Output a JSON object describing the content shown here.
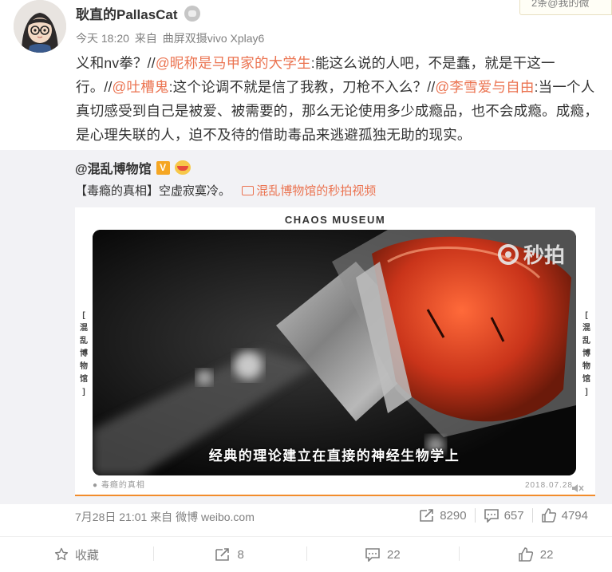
{
  "notice": {
    "text": "2条@我的微"
  },
  "post": {
    "username": "耿直的PallasCat",
    "time": "今天 18:20",
    "from_prefix": "来自",
    "source": "曲屏双摄vivo Xplay6",
    "text_segments": [
      {
        "t": "义和nv拳？//",
        "link": false
      },
      {
        "t": "@昵称是马甲家的大学生",
        "link": true
      },
      {
        "t": ":能这么说的人吧，不是蠢，就是干这一行。//",
        "link": false
      },
      {
        "t": "@吐槽鬼",
        "link": true
      },
      {
        "t": ":这个论调不就是信了我教，刀枪不入么？//",
        "link": false
      },
      {
        "t": "@李雪爱与自由",
        "link": true
      },
      {
        "t": ":当一个人真切感受到自己是被爱、被需要的，那么无论使用多少成瘾品，也不会成瘾。成瘾，是心理失联的人，迫不及待的借助毒品来逃避孤独无助的现实。",
        "link": false
      }
    ]
  },
  "repost": {
    "username": "@混乱博物馆",
    "text": "【毒瘾的真相】空虚寂寞冷。",
    "video_link": "混乱博物馆的秒拍视频",
    "video": {
      "title": "CHAOS MUSEUM",
      "side_left": [
        "混",
        "乱",
        "博",
        "物",
        "馆"
      ],
      "side_right": [
        "混",
        "乱",
        "博",
        "物",
        "馆"
      ],
      "watermark": "秒拍",
      "caption": "经典的理论建立在直接的神经生物学上",
      "footer_left": "毒瘾的真相",
      "footer_right": "2018.07.28"
    },
    "date": "7月28日 21:01",
    "from_prefix": "来自",
    "source": "微博 weibo.com",
    "stats": {
      "reposts": "8290",
      "comments": "657",
      "likes": "4794"
    }
  },
  "actions": {
    "favorite": "收藏",
    "repost": "8",
    "comment": "22",
    "like": "22"
  },
  "colors": {
    "link": "#eb7350",
    "repost_bg": "#f2f2f5",
    "progress": "#f28c2c"
  }
}
